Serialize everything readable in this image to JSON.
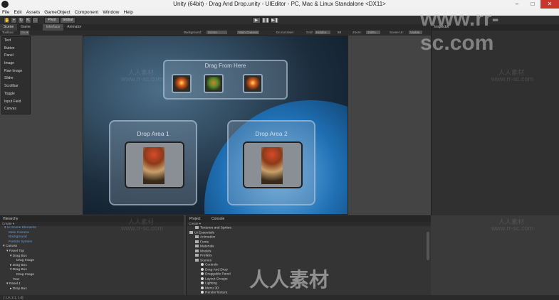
{
  "title": "Unity (64bit) - Drag And Drop.unity - UIEditor - PC, Mac & Linux Standalone <DX11>",
  "menu": [
    "File",
    "Edit",
    "Assets",
    "GameObject",
    "Component",
    "Window",
    "Help"
  ],
  "toolbar": {
    "pivot": "Pivot",
    "global": "Global"
  },
  "tabs": {
    "scene": "Scene",
    "game": "Game",
    "interface": "Interface",
    "animator": "Animator",
    "inspector": "Inspector"
  },
  "scene_options": {
    "toolbox": "Toolbox:",
    "toolbox_btn": "Gc ▾",
    "background_label": "Background:",
    "background_value": "Scene",
    "camera": "Main Camera",
    "donotinsert": "Do not insel",
    "grid_label": "Grid:",
    "grid_value": "Hidden",
    "grid_num": "88",
    "zoom_label": "Zoom:",
    "zoom_value": "150%",
    "scene_ui_label": "Scene UI:",
    "scene_ui_value": "Visible"
  },
  "toolbox_items": [
    "Text",
    "Button",
    "Panel",
    "Image",
    "Raw Image",
    "Slider",
    "Scrollbar",
    "Toggle",
    "Input Field",
    "Canvas"
  ],
  "game": {
    "drag_from": "Drag From Here",
    "drop1": "Drop Area 1",
    "drop2": "Drop Area 2"
  },
  "hierarchy": {
    "header": "Hierarchy",
    "create": "Create ▾",
    "rows": [
      {
        "text": "▾ UI Scene Elements",
        "indent": 6,
        "blue": true
      },
      {
        "text": "Main Camera",
        "indent": 12,
        "blue": true
      },
      {
        "text": "Background",
        "indent": 12,
        "blue": true
      },
      {
        "text": "Particle System",
        "indent": 12,
        "blue": true
      },
      {
        "text": "▾ Canvas",
        "indent": 4,
        "blue": false
      },
      {
        "text": "▾ Panel Top",
        "indent": 9,
        "blue": false
      },
      {
        "text": "▾ Drag Box",
        "indent": 14,
        "blue": false
      },
      {
        "text": "Drag Image",
        "indent": 23,
        "blue": false
      },
      {
        "text": "▸ Drag Box",
        "indent": 14,
        "blue": false
      },
      {
        "text": "▾ Drag Box",
        "indent": 14,
        "blue": false
      },
      {
        "text": "Drag Image",
        "indent": 23,
        "blue": false
      },
      {
        "text": "Text",
        "indent": 18,
        "blue": false
      },
      {
        "text": "▾ Panel 1",
        "indent": 9,
        "blue": false
      },
      {
        "text": "▸ Drop Box",
        "indent": 14,
        "blue": false
      }
    ]
  },
  "project": {
    "header": "Project",
    "console": "Console",
    "create": "Create ▾",
    "rows": [
      {
        "text": "Textures and Sprites",
        "indent": 12,
        "folder": true
      },
      {
        "text": "UI Essentials",
        "indent": 4,
        "folder": true
      },
      {
        "text": "Animation",
        "indent": 12,
        "folder": true
      },
      {
        "text": "Fonts",
        "indent": 12,
        "folder": true
      },
      {
        "text": "Materials",
        "indent": 12,
        "folder": true
      },
      {
        "text": "Models",
        "indent": 12,
        "folder": true
      },
      {
        "text": "Prefabs",
        "indent": 12,
        "folder": true
      },
      {
        "text": "Scenes",
        "indent": 12,
        "folder": true
      },
      {
        "text": "Controls",
        "indent": 20,
        "folder": false
      },
      {
        "text": "Drag And Drop",
        "indent": 20,
        "folder": false
      },
      {
        "text": "Draggable Panel",
        "indent": 20,
        "folder": false
      },
      {
        "text": "Layout Groups",
        "indent": 20,
        "folder": false
      },
      {
        "text": "Lighting",
        "indent": 20,
        "folder": false
      },
      {
        "text": "Menu 3D",
        "indent": 20,
        "folder": false
      },
      {
        "text": "RenderTexture",
        "indent": 20,
        "folder": false
      }
    ]
  },
  "status": "[ 1.0, 2.1, 1.0]",
  "watermark": {
    "url": "www.rr-sc.com",
    "cn": "人人素材"
  },
  "colors": {
    "accent": "#6a9bd8",
    "close": "#c7372e"
  }
}
